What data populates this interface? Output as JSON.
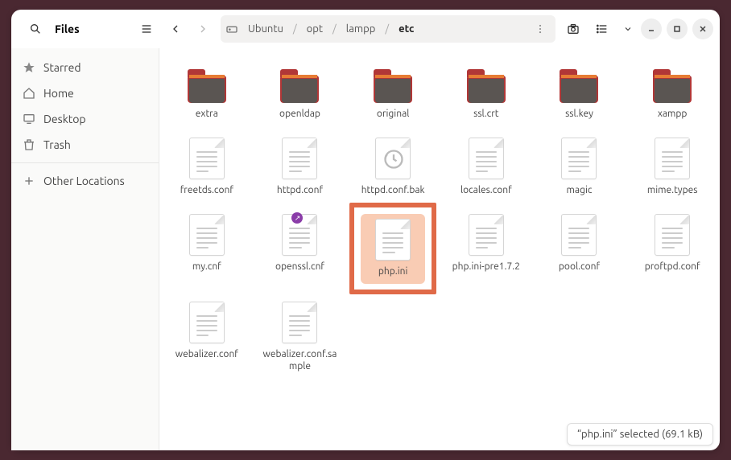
{
  "app_title": "Files",
  "breadcrumb": {
    "root_icon": "drive",
    "segments": [
      "Ubuntu",
      "opt",
      "lampp",
      "etc"
    ],
    "current_index": 3
  },
  "sidebar": {
    "items": [
      {
        "icon": "star",
        "label": "Starred"
      },
      {
        "icon": "home",
        "label": "Home"
      },
      {
        "icon": "desktop",
        "label": "Desktop"
      },
      {
        "icon": "trash",
        "label": "Trash"
      }
    ],
    "other_locations": {
      "icon": "plus",
      "label": "Other Locations"
    }
  },
  "files": [
    {
      "type": "folder",
      "name": "extra"
    },
    {
      "type": "folder",
      "name": "openldap"
    },
    {
      "type": "folder",
      "name": "original"
    },
    {
      "type": "folder",
      "name": "ssl.crt"
    },
    {
      "type": "folder",
      "name": "ssl.key"
    },
    {
      "type": "folder",
      "name": "xampp"
    },
    {
      "type": "file",
      "name": "freetds.conf"
    },
    {
      "type": "file",
      "name": "httpd.conf"
    },
    {
      "type": "file-bak",
      "name": "httpd.conf.bak"
    },
    {
      "type": "file",
      "name": "locales.conf"
    },
    {
      "type": "file",
      "name": "magic"
    },
    {
      "type": "file",
      "name": "mime.types"
    },
    {
      "type": "file",
      "name": "my.cnf"
    },
    {
      "type": "file",
      "name": "openssl.cnf",
      "emblem": "link"
    },
    {
      "type": "file",
      "name": "php.ini",
      "selected": true,
      "highlighted": true
    },
    {
      "type": "file",
      "name": "php.ini-pre1.7.2"
    },
    {
      "type": "file",
      "name": "pool.conf"
    },
    {
      "type": "file",
      "name": "proftpd.conf"
    },
    {
      "type": "file",
      "name": "webalizer.conf"
    },
    {
      "type": "file",
      "name": "webalizer.conf.sample"
    }
  ],
  "status": {
    "text": "“php.ini” selected  (69.1 kB)"
  }
}
